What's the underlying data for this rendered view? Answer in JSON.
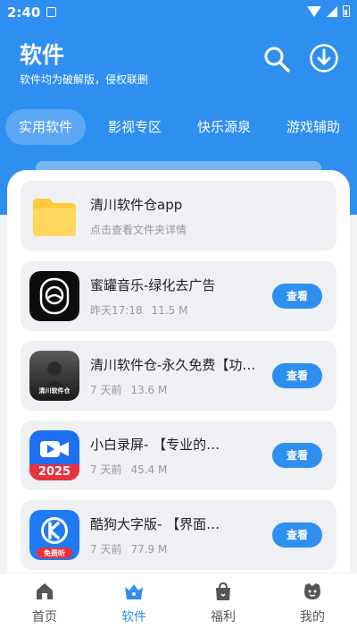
{
  "status": {
    "time": "2:40"
  },
  "header": {
    "title": "软件",
    "subtitle": "软件均为破解版，侵权联删"
  },
  "tabs": [
    {
      "label": "实用软件",
      "active": true
    },
    {
      "label": "影视专区",
      "active": false
    },
    {
      "label": "快乐源泉",
      "active": false
    },
    {
      "label": "游戏辅助",
      "active": false
    }
  ],
  "folder_card": {
    "name": "清川软件仓app",
    "hint": "点击查看文件夹详情"
  },
  "apps": [
    {
      "name": "蜜罐音乐-绿化去广告",
      "time": "昨天17:18",
      "size": "11.5 M",
      "button": "查看",
      "icon_label": ""
    },
    {
      "name": "清川软件仓-永久免费【功…",
      "time": "7 天前",
      "size": "13.6 M",
      "button": "查看",
      "icon_label": "清川软件仓"
    },
    {
      "name": "小白录屏-      【专业的…",
      "time": "7 天前",
      "size": "45.4 M",
      "button": "查看",
      "icon_label": "2025"
    },
    {
      "name": "酷狗大字版-      【界面…",
      "time": "7 天前",
      "size": "77.9 M",
      "button": "查看",
      "icon_label": "免费听"
    }
  ],
  "nav": [
    {
      "label": "首页",
      "icon": "home-icon",
      "active": false
    },
    {
      "label": "软件",
      "icon": "crown-icon",
      "active": true
    },
    {
      "label": "福利",
      "icon": "gift-bag-icon",
      "active": false
    },
    {
      "label": "我的",
      "icon": "profile-icon",
      "active": false
    }
  ],
  "colors": {
    "primary": "#2e8ff0",
    "card_bg": "#eef0f4",
    "folder": "#ffc93a"
  }
}
